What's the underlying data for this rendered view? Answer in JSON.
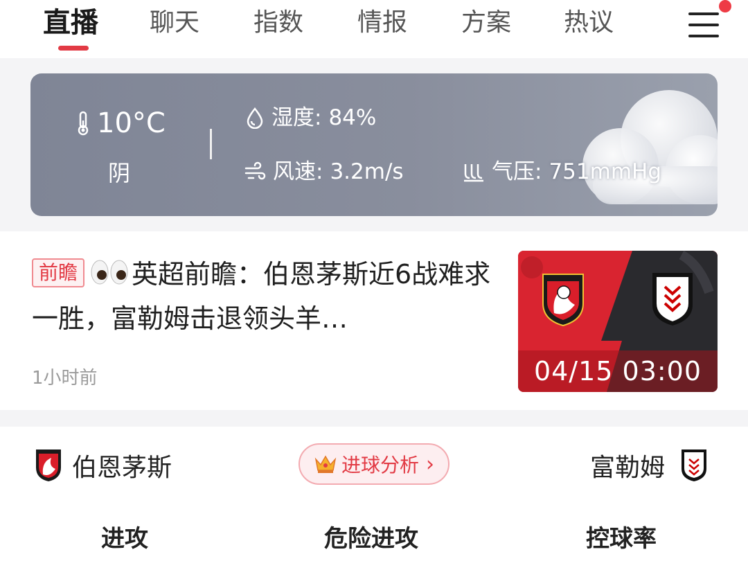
{
  "tabs": [
    {
      "label": "直播",
      "active": true
    },
    {
      "label": "聊天"
    },
    {
      "label": "指数"
    },
    {
      "label": "情报"
    },
    {
      "label": "方案"
    },
    {
      "label": "热议"
    }
  ],
  "icons": {
    "menu": "hamburger-menu-icon",
    "notification_dot": "red-dot",
    "temperature": "thermometer-icon",
    "humidity": "water-drop-icon",
    "wind": "wind-icon",
    "pressure": "pressure-icon",
    "cloud": "cloud-icon",
    "analysis": "crown-icon"
  },
  "weather": {
    "temperature": "10°C",
    "condition": "阴",
    "humidity_label": "湿度:",
    "humidity_value": "84%",
    "wind_label": "风速:",
    "wind_value": "3.2m/s",
    "pressure_label": "气压:",
    "pressure_value": "751mmHg"
  },
  "news": {
    "tag": "前瞻",
    "title": "英超前瞻：伯恩茅斯近6战难求一胜，富勒姆击退领头羊…",
    "time": "1小时前",
    "thumbnail_date": "04/15  03:00"
  },
  "match": {
    "home_team": "伯恩茅斯",
    "away_team": "富勒姆",
    "analysis_label": "进球分析",
    "analysis_chevron": "›"
  },
  "stats": {
    "attack": "进攻",
    "dangerous_attack": "危险进攻",
    "possession": "控球率"
  },
  "colors": {
    "accent": "#e23a44",
    "weather_card": "#858a9a",
    "home_team_red": "#d92430",
    "away_team_black": "#1a1a1a"
  }
}
